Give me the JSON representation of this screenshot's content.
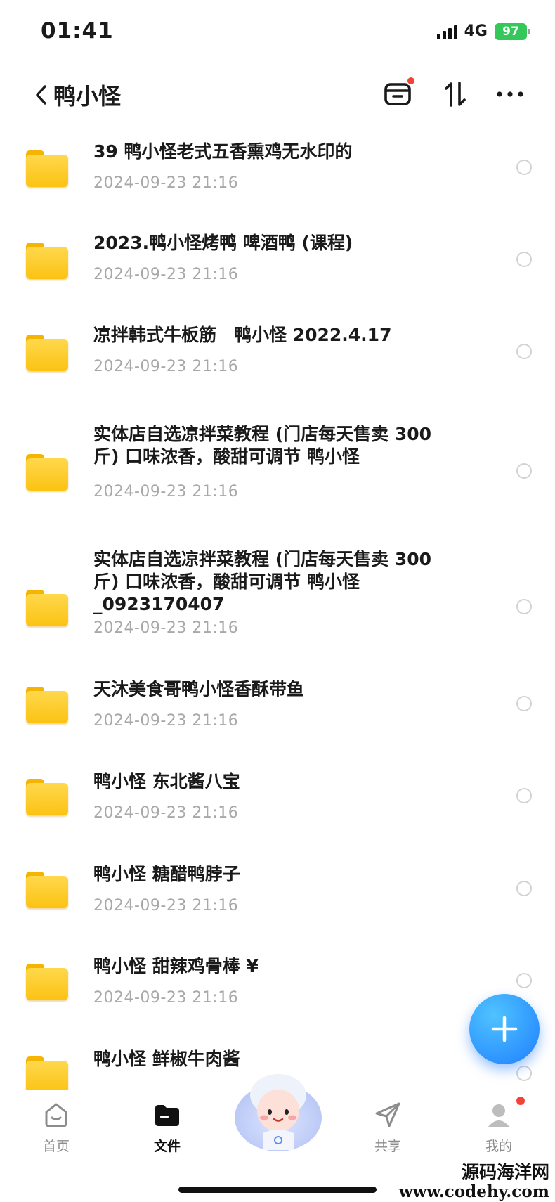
{
  "status_bar": {
    "time": "01:41",
    "network": "4G",
    "battery": "97"
  },
  "header": {
    "title": "鸭小怪"
  },
  "files": [
    {
      "name": "39 鸭小怪老式五香熏鸡无水印的",
      "date": "2024-09-23 21:16"
    },
    {
      "name": "2023.鸭小怪烤鸭 啤酒鸭 (课程)",
      "date": "2024-09-23 21:16"
    },
    {
      "name": "凉拌韩式牛板筋　鸭小怪 2022.4.17",
      "date": "2024-09-23 21:16"
    },
    {
      "name": "实体店自选凉拌菜教程 (门店每天售卖 300 斤) 口味浓香，酸甜可调节 鸭小怪",
      "date": "2024-09-23 21:16"
    },
    {
      "name": "实体店自选凉拌菜教程 (门店每天售卖 300 斤) 口味浓香，酸甜可调节 鸭小怪 _0923170407",
      "date": "2024-09-23 21:16"
    },
    {
      "name": "天沐美食哥鸭小怪香酥带鱼",
      "date": "2024-09-23 21:16"
    },
    {
      "name": "鸭小怪 东北酱八宝",
      "date": "2024-09-23 21:16"
    },
    {
      "name": "鸭小怪 糖醋鸭脖子",
      "date": "2024-09-23 21:16"
    },
    {
      "name": "鸭小怪 甜辣鸡骨棒 ¥",
      "date": "2024-09-23 21:16"
    },
    {
      "name": "鸭小怪 鲜椒牛肉酱",
      "date": ""
    }
  ],
  "bottom_nav": {
    "home": "首页",
    "files": "文件",
    "share": "共享",
    "mine": "我的"
  },
  "watermark": {
    "line1": "源码海洋网",
    "line2": "www.codehy.com"
  },
  "colors": {
    "accent": "#1f7fff",
    "folder": "#fbc312",
    "badge": "#f44336",
    "battery": "#34c759"
  }
}
